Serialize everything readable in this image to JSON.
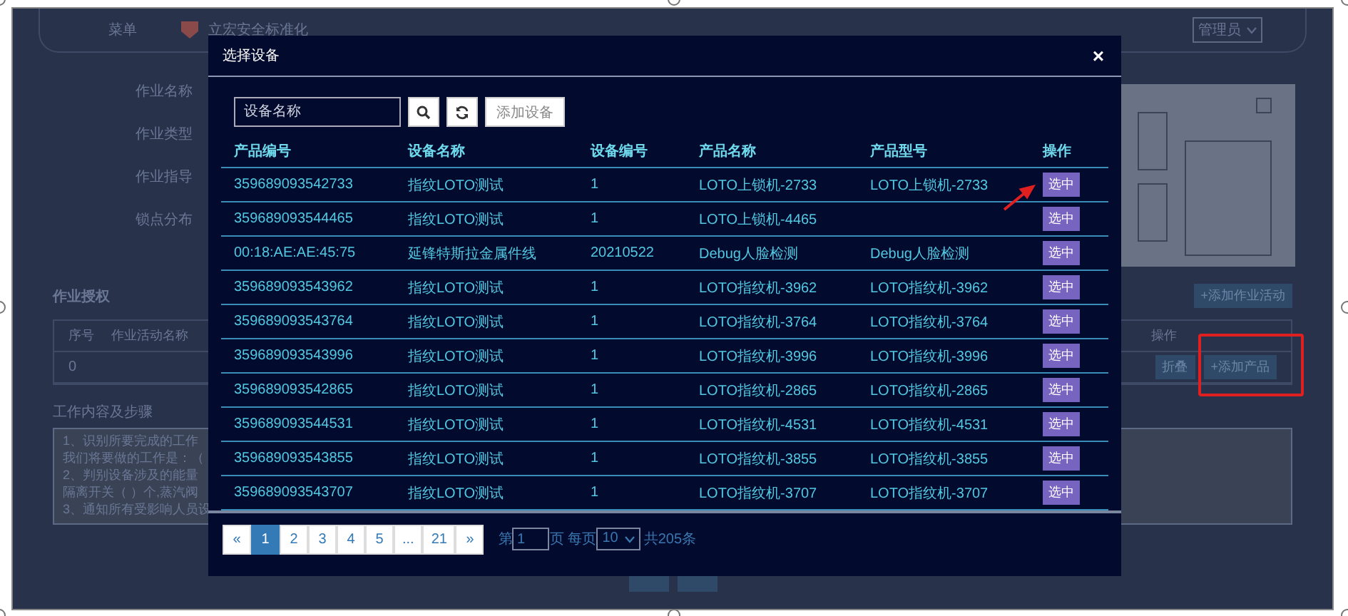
{
  "background_page": {
    "menu_label": "菜单",
    "logo_text": "立宏安全标准化",
    "user_menu": "管理员",
    "form_labels": [
      "作业名称",
      "作业类型",
      "作业指导",
      "锁点分布"
    ],
    "section_title": "作业授权",
    "add_activity_button": "+添加作业活动",
    "activity_table": {
      "columns": [
        "序号",
        "作业活动名称",
        "操作"
      ],
      "rows": [
        {
          "index": "0",
          "collapse_button": "折叠",
          "add_product_button": "+添加产品"
        }
      ]
    },
    "steps_label": "工作内容及步骤",
    "steps_lines": [
      "1、识别所要完成的工作",
      "我们将要做的工作是：（",
      "2、判别设备涉及的能量",
      "隔离开关（  ）个,蒸汽阀",
      "3、通知所有受影响人员设"
    ]
  },
  "dialog": {
    "title": "选择设备",
    "close": "×",
    "search": {
      "placeholder": "设备名称"
    },
    "add_button": "添加设备",
    "table": {
      "columns": [
        "产品编号",
        "设备名称",
        "设备编号",
        "产品名称",
        "产品型号",
        "操作"
      ],
      "rows": [
        {
          "product_id": "359689093542733",
          "device_name": "指纹LOTO测试",
          "device_no": "1",
          "product_name": "LOTO上锁机-2733",
          "product_model": "LOTO上锁机-2733",
          "action": "选中"
        },
        {
          "product_id": "359689093544465",
          "device_name": "指纹LOTO测试",
          "device_no": "1",
          "product_name": "LOTO上锁机-4465",
          "action": "选中"
        },
        {
          "product_id": "00:18:AE:AE:45:75",
          "device_name": "延锋特斯拉金属件线",
          "device_no": "20210522",
          "product_name": "Debug人脸检测",
          "product_model": "Debug人脸检测",
          "action": "选中"
        },
        {
          "product_id": "359689093543962",
          "device_name": "指纹LOTO测试",
          "device_no": "1",
          "product_name": "LOTO指纹机-3962",
          "product_model": "LOTO指纹机-3962",
          "action": "选中"
        },
        {
          "product_id": "359689093543764",
          "device_name": "指纹LOTO测试",
          "device_no": "1",
          "product_name": "LOTO指纹机-3764",
          "product_model": "LOTO指纹机-3764",
          "action": "选中"
        },
        {
          "product_id": "359689093543996",
          "device_name": "指纹LOTO测试",
          "device_no": "1",
          "product_name": "LOTO指纹机-3996",
          "product_model": "LOTO指纹机-3996",
          "action": "选中"
        },
        {
          "product_id": "359689093542865",
          "device_name": "指纹LOTO测试",
          "device_no": "1",
          "product_name": "LOTO指纹机-2865",
          "product_model": "LOTO指纹机-2865",
          "action": "选中"
        },
        {
          "product_id": "359689093544531",
          "device_name": "指纹LOTO测试",
          "device_no": "1",
          "product_name": "LOTO指纹机-4531",
          "product_model": "LOTO指纹机-4531",
          "action": "选中"
        },
        {
          "product_id": "359689093543855",
          "device_name": "指纹LOTO测试",
          "device_no": "1",
          "product_name": "LOTO指纹机-3855",
          "product_model": "LOTO指纹机-3855",
          "action": "选中"
        },
        {
          "product_id": "359689093543707",
          "device_name": "指纹LOTO测试",
          "device_no": "1",
          "product_name": "LOTO指纹机-3707",
          "product_model": "LOTO指纹机-3707",
          "action": "选中"
        }
      ]
    },
    "pagination": {
      "prev": "«",
      "pages": [
        {
          "label": "1",
          "selected": true
        },
        {
          "label": "2",
          "selected": false
        },
        {
          "label": "3",
          "selected": false
        },
        {
          "label": "4",
          "selected": false
        },
        {
          "label": "5",
          "selected": false
        },
        {
          "label": "...",
          "selected": false
        },
        {
          "label": "21",
          "selected": false
        }
      ],
      "next": "»",
      "page_prefix": "第",
      "page_value": "1",
      "page_suffix": "页 每页",
      "page_size": "10",
      "total": "共205条"
    }
  }
}
